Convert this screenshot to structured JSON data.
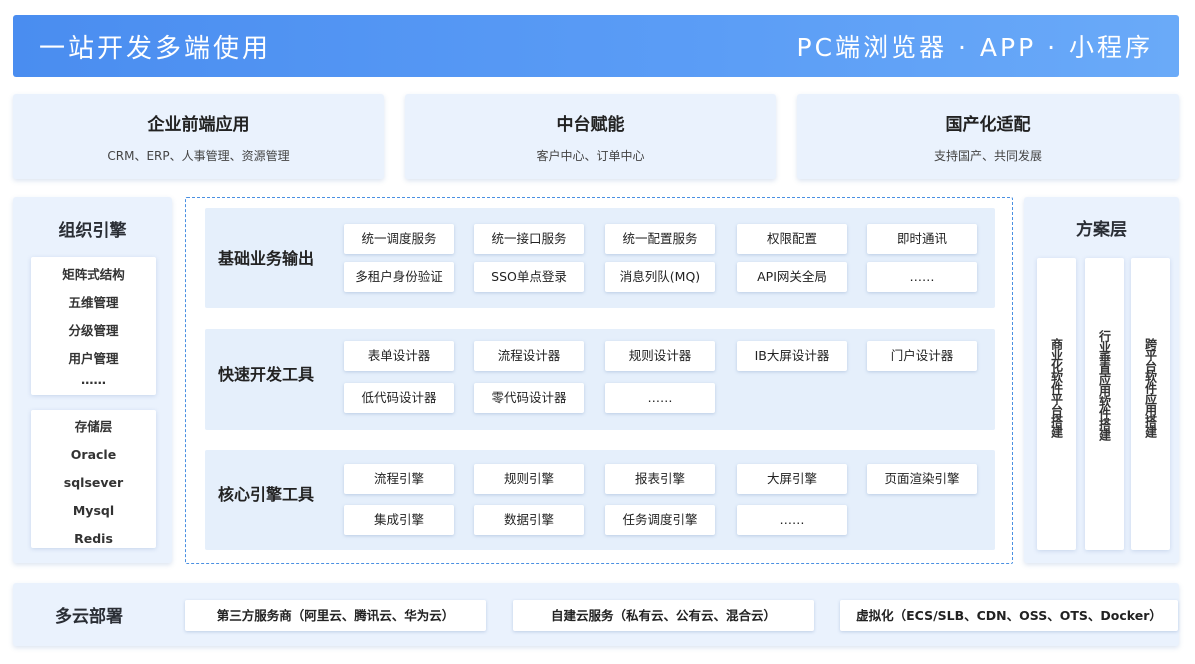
{
  "header": {
    "title": "一站开发多端使用",
    "subtitle": "PC端浏览器 · APP · 小程序"
  },
  "top_cards": [
    {
      "title": "企业前端应用",
      "subtitle": "CRM、ERP、人事管理、资源管理"
    },
    {
      "title": "中台赋能",
      "subtitle": "客户中心、订单中心"
    },
    {
      "title": "国产化适配",
      "subtitle": "支持国产、共同发展"
    }
  ],
  "left_panel": {
    "title": "组织引擎",
    "org_items": [
      "矩阵式结构",
      "五维管理",
      "分级管理",
      "用户管理",
      "……"
    ],
    "storage_items": [
      "存储层",
      "Oracle",
      "sqlsever",
      "Mysql",
      "Redis"
    ]
  },
  "rows": [
    {
      "label": "基础业务输出",
      "chips": [
        "统一调度服务",
        "统一接口服务",
        "统一配置服务",
        "权限配置",
        "即时通讯",
        "多租户身份验证",
        "SSO单点登录",
        "消息列队(MQ)",
        "API网关全局",
        "……"
      ]
    },
    {
      "label": "快速开发工具",
      "chips": [
        "表单设计器",
        "流程设计器",
        "规则设计器",
        "IB大屏设计器",
        "门户设计器",
        "低代码设计器",
        "零代码设计器",
        "……"
      ]
    },
    {
      "label": "核心引擎工具",
      "chips": [
        "流程引擎",
        "规则引擎",
        "报表引擎",
        "大屏引擎",
        "页面渲染引擎",
        "集成引擎",
        "数据引擎",
        "任务调度引擎",
        "……"
      ]
    }
  ],
  "right_panel": {
    "title": "方案层",
    "columns": [
      "商业化软件平台搭建",
      "行业垂直应用软件搭建",
      "跨平台软件应用搭建"
    ]
  },
  "deploy": {
    "title": "多云部署",
    "items": [
      "第三方服务商（阿里云、腾讯云、华为云）",
      "自建云服务（私有云、公有云、混合云）",
      "虚拟化（ECS/SLB、CDN、OSS、OTS、Docker）"
    ]
  }
}
